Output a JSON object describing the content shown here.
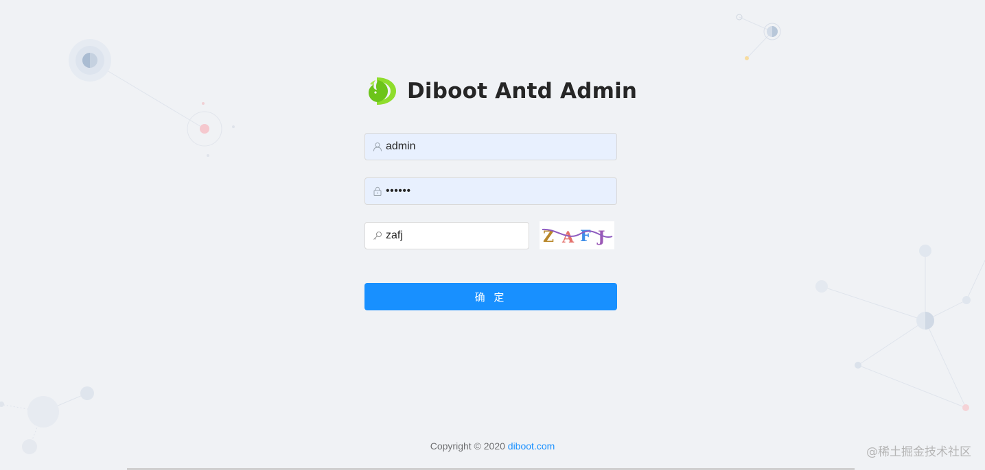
{
  "app": {
    "title": "Diboot Antd Admin"
  },
  "login": {
    "username_value": "admin",
    "password_value": "••••••",
    "captcha_value": "zafj",
    "captcha_image_text": "ZAFJ",
    "submit_label": "确 定"
  },
  "icons": {
    "username": "user-icon",
    "password": "lock-icon",
    "captcha": "key-icon",
    "logo": "diboot-logo"
  },
  "footer": {
    "copyright": "Copyright © 2020 ",
    "link_text": "diboot.com"
  },
  "watermark": "@稀土掘金技术社区",
  "colors": {
    "primary": "#1890ff",
    "background": "#f0f2f5",
    "autofill": "#e8f0fe",
    "logo_green": "#7ed321"
  }
}
